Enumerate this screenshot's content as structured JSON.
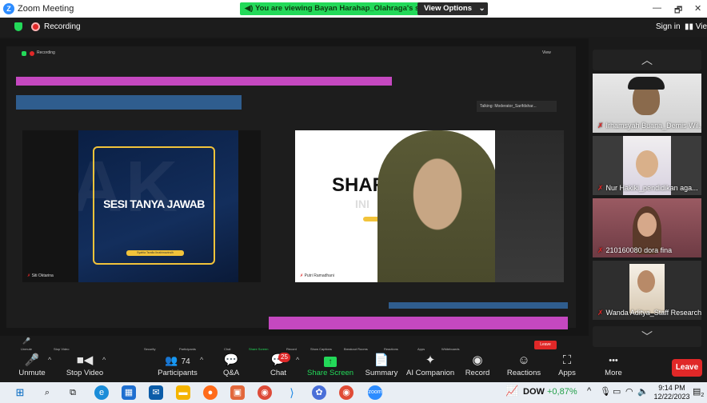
{
  "window": {
    "title": "Zoom Meeting",
    "app_icon": "Z",
    "controls": [
      "—",
      "🗗",
      "✕"
    ]
  },
  "banner": {
    "text": "You are viewing Bayan Harahap_Olahraga's screen",
    "view_options": "View Options",
    "chevron": "⌄"
  },
  "recording": {
    "label": "Recording",
    "sign_in": "Sign in",
    "view": "View"
  },
  "inner": {
    "recording": "Recording",
    "view": "View",
    "talking": "Talking: Moderator_Sarifdshar...",
    "slide_left_title": "SESI TANYA JAWAB",
    "slide_left_bg": "AK",
    "slide_left_label": "Syafria Tsrafia Ibrahimavinsih",
    "slide_left_name": "Siti Oktarina",
    "slide_right_text": "SHAR",
    "slide_right_text2": "S",
    "slide_right_sub": "INI",
    "slide_right_name": "Putri Ramadhani",
    "leave": "Leave",
    "mini_toolbar": [
      "Unmute",
      "Stop Video",
      "Security",
      "Participants",
      "Chat",
      "Share Screen",
      "Record",
      "Show Captions",
      "Breakout Rooms",
      "Reactions",
      "Apps",
      "Whiteboards"
    ],
    "mini_participants": "16"
  },
  "gallery": {
    "participants": [
      {
        "name": "Irhamsyah Buana_Demis Wil..."
      },
      {
        "name": "Nur Hakiki_pendidikan aga..."
      },
      {
        "name": "210160080 dora fina"
      },
      {
        "name": "Wanda Aditya_Staff Research"
      }
    ],
    "up": "︿",
    "down": "﹀"
  },
  "toolbar": {
    "unmute": "Unmute",
    "stop_video": "Stop Video",
    "participants": "Participants",
    "participants_count": "74",
    "qa": "Q&A",
    "chat": "Chat",
    "chat_badge": "25",
    "share_screen": "Share Screen",
    "summary": "Summary",
    "ai_companion": "AI Companion",
    "record": "Record",
    "reactions": "Reactions",
    "apps": "Apps",
    "more": "More",
    "more_dots": "•••",
    "leave": "Leave"
  },
  "taskbar": {
    "stock": "DOW",
    "stock_change": "+0,87%",
    "time": "9:14 PM",
    "date": "12/22/2023",
    "notif": "2"
  },
  "colors": {
    "accent_green": "#23d959",
    "leave_red": "#e02828",
    "bar_pink": "#c548c0",
    "bar_blue": "#2f5d8e"
  }
}
